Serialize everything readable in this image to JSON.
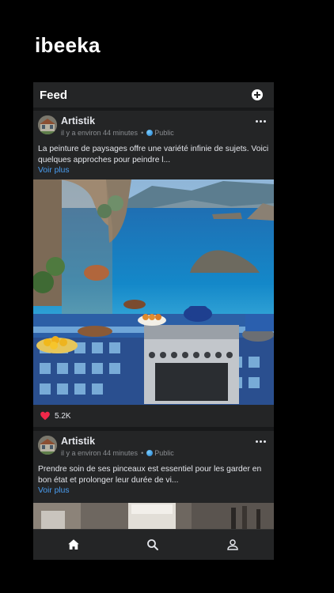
{
  "app": {
    "brand": "ibeeka"
  },
  "feed": {
    "title": "Feed"
  },
  "posts": [
    {
      "author": "Artistik",
      "time": "il y a environ 44 minutes",
      "separator": "•",
      "visibility": "Public",
      "text": "La peinture de paysages offre une variété infinie de sujets. Voici quelques approches pour peindre l...",
      "see_more": "Voir plus",
      "likes": "5.2K"
    },
    {
      "author": "Artistik",
      "time": "il y a environ 44 minutes",
      "separator": "•",
      "visibility": "Public",
      "text": "Prendre soin de ses pinceaux est essentiel pour les garder en bon état et prolonger leur durée de vi...",
      "see_more": "Voir plus"
    }
  ],
  "tabs": [
    {
      "icon": "home-icon",
      "active": true
    },
    {
      "icon": "search-icon",
      "active": false
    },
    {
      "icon": "profile-icon",
      "active": false
    }
  ],
  "colors": {
    "background": "#000000",
    "card": "#242526",
    "link": "#4a9ef2",
    "like": "#f0284a"
  }
}
